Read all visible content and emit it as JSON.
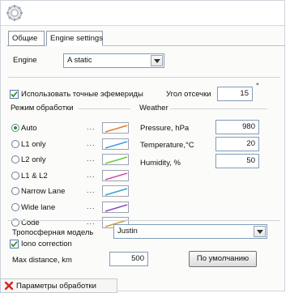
{
  "tabs": {
    "general": "Общие",
    "engine_settings": "Engine settings"
  },
  "engine": {
    "label": "Engine",
    "value": "A static"
  },
  "ephemeris": {
    "checked": true,
    "label": "Использовать точные эфемериды"
  },
  "cutoff": {
    "label": "Угол отсечки",
    "value": "15",
    "unit": "°"
  },
  "processing_modes": {
    "title": "Режим обработки",
    "selected": "Auto",
    "items": [
      {
        "label": "Auto",
        "dots": "...",
        "color": "#e87a2a"
      },
      {
        "label": "L1 only",
        "dots": "...",
        "color": "#3da0e0"
      },
      {
        "label": "L2 only",
        "dots": "...",
        "color": "#6acb3b"
      },
      {
        "label": "L1 & L2",
        "dots": "...",
        "color": "#d14fb0"
      },
      {
        "label": "Narrow Lane",
        "dots": "...",
        "color": "#3aa0d8"
      },
      {
        "label": "Wide lane",
        "dots": "...",
        "color": "#8a4fc0"
      },
      {
        "label": "Code",
        "dots": "...",
        "color": "#c9a431"
      }
    ]
  },
  "weather": {
    "title": "Weather",
    "pressure": {
      "label": "Pressure, hPa",
      "value": "980"
    },
    "temperature": {
      "label": "Temperature,°C",
      "value": "20"
    },
    "humidity": {
      "label": "Humidity, %",
      "value": "50"
    }
  },
  "troposphere": {
    "label": "Тропосферная модель",
    "value": "Justin"
  },
  "iono": {
    "checked": true,
    "label": "Iono correction"
  },
  "max_distance": {
    "label": "Max distance, km",
    "value": "500"
  },
  "default_button": "По умолчанию",
  "bottom_tab": {
    "label": "Параметры обработки",
    "icon": "red-x-icon"
  }
}
